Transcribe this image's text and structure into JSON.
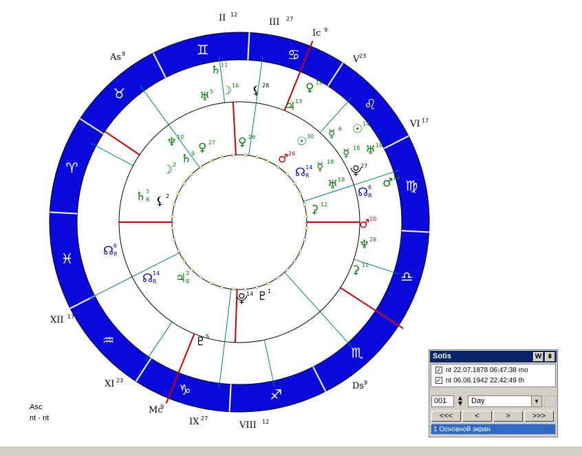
{
  "zodiac": [
    {
      "name": "taurus",
      "glyph": "♉"
    },
    {
      "name": "gemini",
      "glyph": "♊"
    },
    {
      "name": "cancer",
      "glyph": "♋"
    },
    {
      "name": "leo",
      "glyph": "♌"
    },
    {
      "name": "virgo",
      "glyph": "♍"
    },
    {
      "name": "libra",
      "glyph": "♎"
    },
    {
      "name": "scorpio",
      "glyph": "♏"
    },
    {
      "name": "sagittarius",
      "glyph": "♐"
    },
    {
      "name": "capricorn",
      "glyph": "♑"
    },
    {
      "name": "aquarius",
      "glyph": "♒"
    },
    {
      "name": "pisces",
      "glyph": "♓"
    },
    {
      "name": "aries",
      "glyph": "♈"
    }
  ],
  "cusps": {
    "as": {
      "label": "As",
      "deg": "9"
    },
    "ii": {
      "label": "II",
      "deg": "12"
    },
    "iii": {
      "label": "III",
      "deg": "27"
    },
    "ic": {
      "label": "Ic",
      "deg": "9"
    },
    "v": {
      "label": "V",
      "deg": "23"
    },
    "vi": {
      "label": "VI",
      "deg": "17"
    },
    "ds": {
      "label": "Ds",
      "deg": "9"
    },
    "viii": {
      "label": "VIII",
      "deg": "12"
    },
    "ix": {
      "label": "IX",
      "deg": "27"
    },
    "mc": {
      "label": "Mc",
      "deg": "9"
    },
    "xi": {
      "label": "XI",
      "deg": "23"
    },
    "xii": {
      "label": "XII",
      "deg": "17"
    }
  },
  "planets": [
    {
      "glyph": "♄",
      "deg": "11",
      "color": "#008000",
      "retro": ""
    },
    {
      "glyph": "☽",
      "deg": "16",
      "color": "#008000",
      "retro": ""
    },
    {
      "glyph": "♅",
      "deg": "5",
      "color": "#008000",
      "retro": ""
    },
    {
      "glyph": "⚸",
      "deg": "28",
      "color": "#000000",
      "retro": ""
    },
    {
      "glyph": "♀",
      "deg": "18",
      "color": "#008000",
      "retro": ""
    },
    {
      "glyph": "♃",
      "deg": "13",
      "color": "#008000",
      "retro": ""
    },
    {
      "glyph": "☉",
      "deg": "14",
      "color": "#008000",
      "retro": ""
    },
    {
      "glyph": "☿",
      "deg": "6",
      "color": "#008000",
      "retro": ""
    },
    {
      "glyph": "☉",
      "deg": "30",
      "color": "#008000",
      "retro": ""
    },
    {
      "glyph": "♆",
      "deg": "10",
      "color": "#008000",
      "retro": ""
    },
    {
      "glyph": "♀",
      "deg": "27",
      "color": "#008000",
      "retro": ""
    },
    {
      "glyph": "♀",
      "deg": "26",
      "color": "#008000",
      "retro": ""
    },
    {
      "glyph": "♂",
      "deg": "26",
      "color": "#cc0000",
      "retro": ""
    },
    {
      "glyph": "☿",
      "deg": "18",
      "color": "#008000",
      "retro": ""
    },
    {
      "glyph": "♅",
      "deg": "18",
      "color": "#008000",
      "retro": ""
    },
    {
      "glyph": "⯓",
      "deg": "27",
      "color": "#000000",
      "retro": ""
    },
    {
      "glyph": "☽",
      "deg": "2",
      "color": "#008000",
      "retro": ""
    },
    {
      "glyph": "♄",
      "deg": "9",
      "color": "#008000",
      "retro": ""
    },
    {
      "glyph": "☊",
      "deg": "14",
      "color": "#0000cc",
      "retro": "R"
    },
    {
      "glyph": "☊",
      "deg": "6",
      "color": "#0000cc",
      "retro": "R"
    },
    {
      "glyph": "♂",
      "deg": "14",
      "color": "#008000",
      "retro": ""
    },
    {
      "glyph": "☿",
      "deg": "18",
      "color": "#008000",
      "retro": ""
    },
    {
      "glyph": "♅",
      "deg": "19",
      "color": "#008000",
      "retro": ""
    },
    {
      "glyph": "♄",
      "deg": "3",
      "color": "#008000",
      "retro": "R"
    },
    {
      "glyph": "⚸",
      "deg": "2",
      "color": "#000000",
      "retro": ""
    },
    {
      "glyph": "⚳",
      "deg": "12",
      "color": "#008000",
      "retro": ""
    },
    {
      "glyph": "♂",
      "deg": "20",
      "color": "#cc0000",
      "retro": ""
    },
    {
      "glyph": "♆",
      "deg": "28",
      "color": "#008000",
      "retro": ""
    },
    {
      "glyph": "⚳",
      "deg": "11",
      "color": "#008000",
      "retro": ""
    },
    {
      "glyph": "☊",
      "deg": "6",
      "color": "#0000cc",
      "retro": "R"
    },
    {
      "glyph": "☊",
      "deg": "14",
      "color": "#0000cc",
      "retro": "R"
    },
    {
      "glyph": "♃",
      "deg": "3",
      "color": "#008000",
      "retro": "R"
    },
    {
      "glyph": "⯓",
      "deg": "14",
      "color": "#000000",
      "retro": ""
    },
    {
      "glyph": "♇",
      "deg": "1",
      "color": "#000000",
      "retro": ""
    },
    {
      "glyph": "♇",
      "deg": "5",
      "color": "#000000",
      "retro": ""
    }
  ],
  "info": {
    "line1": "Asc",
    "line2": "nt - nt"
  },
  "sotis": {
    "title": "Sotis",
    "w_btn": "W",
    "dock_btn": "⇟",
    "entries": [
      {
        "text": "nt 22.07.1878 06:47:38 mo",
        "checked": "✓"
      },
      {
        "text": "nt 06.08.1942 22:42:49 th",
        "checked": "✓"
      }
    ],
    "step": "001",
    "unit": "Day",
    "nav": [
      "<<<",
      "<",
      ">",
      ">>>"
    ],
    "screen": "1 Основной экран"
  },
  "colors": {
    "ring": "#0a0adc",
    "cusp": "#cc0000",
    "house": "#008080"
  }
}
